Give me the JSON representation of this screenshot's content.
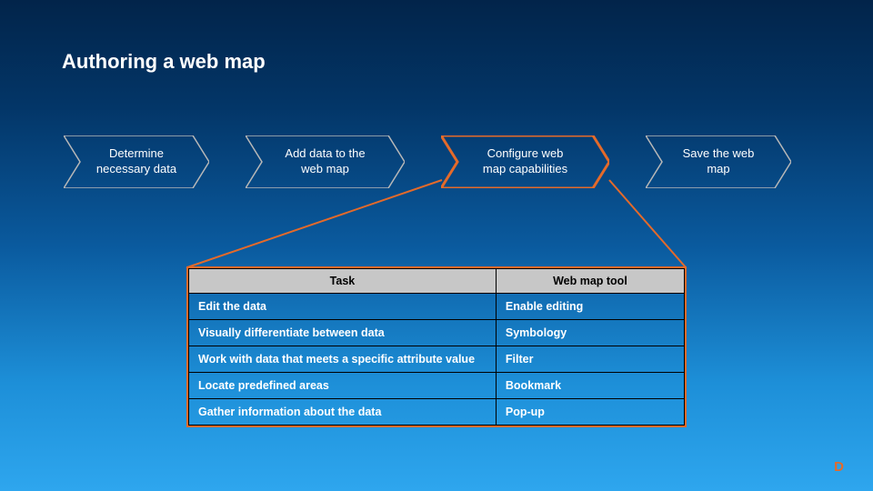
{
  "title": "Authoring a web map",
  "chevrons": [
    {
      "label": "Determine\nnecessary data"
    },
    {
      "label": "Add data to the\nweb map"
    },
    {
      "label": "Configure web\nmap capabilities"
    },
    {
      "label": "Save the web\nmap"
    }
  ],
  "table": {
    "headers": {
      "col1": "Task",
      "col2": "Web map tool"
    },
    "rows": [
      {
        "task": "Edit the data",
        "tool": "Enable editing"
      },
      {
        "task": "Visually differentiate between data",
        "tool": "Symbology"
      },
      {
        "task": "Work with data that meets a specific attribute value",
        "tool": "Filter"
      },
      {
        "task": "Locate predefined areas",
        "tool": "Bookmark"
      },
      {
        "task": "Gather information about the data",
        "tool": "Pop-up"
      }
    ]
  },
  "footer": "D",
  "colors": {
    "highlight": "#e46a2a",
    "chevron_stroke": "#b8b8b8"
  }
}
